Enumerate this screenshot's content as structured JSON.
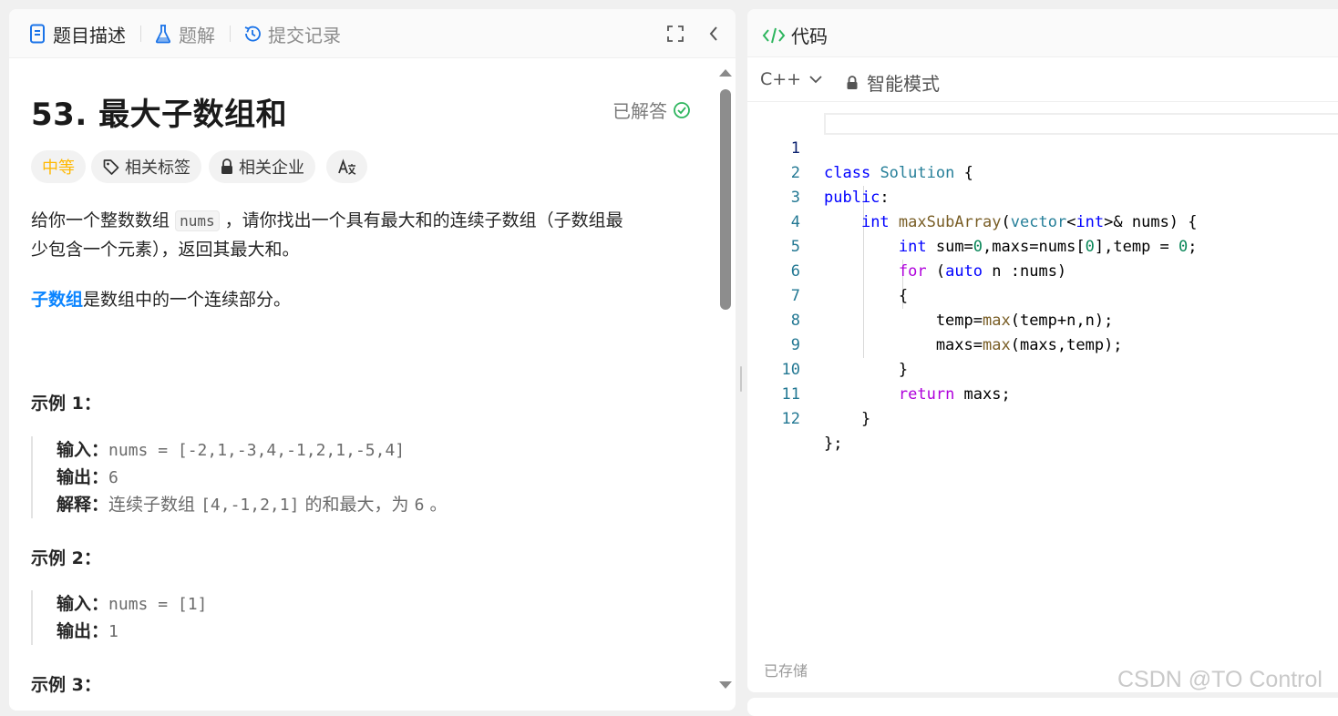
{
  "left_tabs": {
    "description": "题目描述",
    "solutions": "题解",
    "submissions": "提交记录"
  },
  "problem": {
    "title": "53. 最大子数组和",
    "status": "已解答",
    "difficulty": "中等",
    "chips": {
      "tags": "相关标签",
      "companies": "相关企业"
    },
    "desc_line1_a": "给你一个整数数组",
    "desc_code": "nums",
    "desc_line1_b": "，请你找出一个具有最大和的连续子数组（子数组最",
    "desc_line2": "少包含一个元素），返回其最大和。",
    "subarray_link": "子数组",
    "subarray_rest": "是数组中的一个连续部分。"
  },
  "examples": [
    {
      "title": "示例 1：",
      "input_label": "输入：",
      "input": "nums = [-2,1,-3,4,-1,2,1,-5,4]",
      "output_label": "输出：",
      "output": "6",
      "explain_label": "解释：",
      "explain_a": "连续子数组",
      "explain_code": "[4,-1,2,1]",
      "explain_b": "的和最大，为",
      "explain_num": "6",
      "explain_end": "。"
    },
    {
      "title": "示例 2：",
      "input_label": "输入：",
      "input": "nums = [1]",
      "output_label": "输出：",
      "output": "1"
    },
    {
      "title": "示例 3："
    }
  ],
  "editor": {
    "header": "代码",
    "language": "C++",
    "mode": "智能模式",
    "saved": "已存储",
    "line_numbers": [
      "1",
      "2",
      "3",
      "4",
      "5",
      "6",
      "7",
      "8",
      "9",
      "10",
      "11",
      "12"
    ]
  },
  "watermark": "CSDN @TO Control"
}
